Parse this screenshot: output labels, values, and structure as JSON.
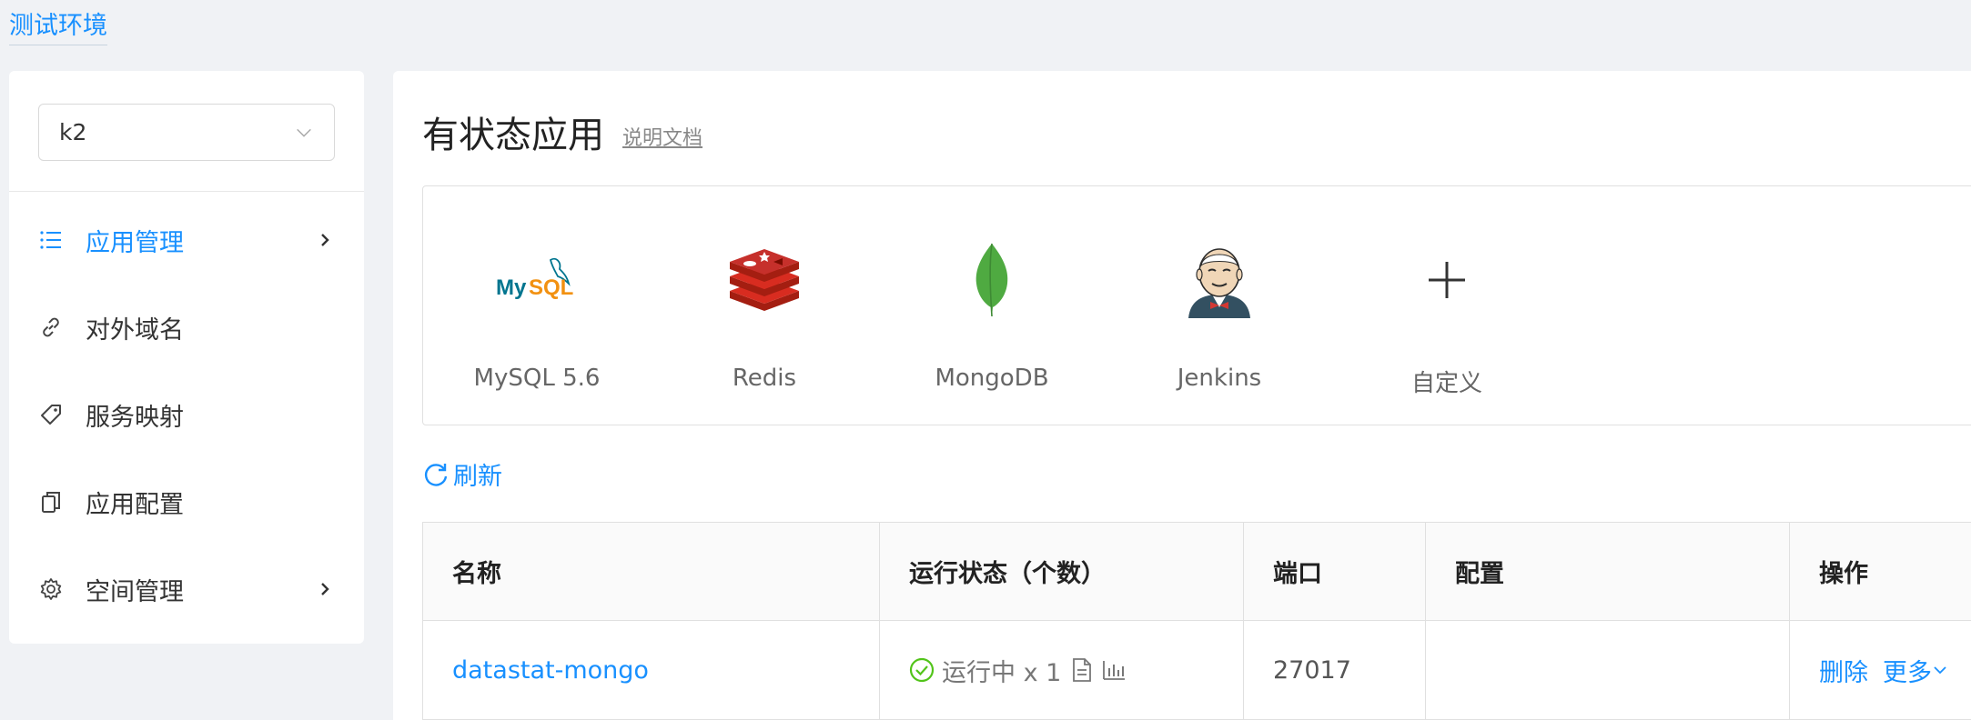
{
  "env": {
    "label": "测试环境"
  },
  "sidebar": {
    "namespace": {
      "value": "k2"
    },
    "items": [
      {
        "label": "应用管理",
        "icon": "list-icon",
        "active": true,
        "has_arrow": true
      },
      {
        "label": "对外域名",
        "icon": "link-icon",
        "active": false,
        "has_arrow": false
      },
      {
        "label": "服务映射",
        "icon": "tag-icon",
        "active": false,
        "has_arrow": false
      },
      {
        "label": "应用配置",
        "icon": "copy-icon",
        "active": false,
        "has_arrow": false
      },
      {
        "label": "空间管理",
        "icon": "gear-icon",
        "active": false,
        "has_arrow": true
      }
    ]
  },
  "main": {
    "title": "有状态应用",
    "doc_link": "说明文档",
    "apps": [
      {
        "name": "MySQL 5.6",
        "icon": "mysql-logo"
      },
      {
        "name": "Redis",
        "icon": "redis-logo"
      },
      {
        "name": "MongoDB",
        "icon": "mongodb-logo"
      },
      {
        "name": "Jenkins",
        "icon": "jenkins-logo"
      },
      {
        "name": "自定义",
        "icon": "plus-icon"
      }
    ],
    "mysql_logo_text": {
      "my": "My",
      "sql": "SQL"
    },
    "refresh_label": "刷新",
    "table": {
      "headers": {
        "name": "名称",
        "status": "运行状态（个数）",
        "port": "端口",
        "config": "配置",
        "ops": "操作"
      },
      "rows": [
        {
          "name": "datastat-mongo",
          "status": "运行中 x 1",
          "port": "27017",
          "config": "",
          "delete_label": "删除",
          "more_label": "更多"
        }
      ]
    }
  },
  "colors": {
    "primary": "#1890ff",
    "success": "#52c41a",
    "background": "#f0f2f5",
    "redis": "#c6302b",
    "mongodb": "#4faa41",
    "mysql_blue": "#00758f",
    "mysql_orange": "#f29111"
  }
}
